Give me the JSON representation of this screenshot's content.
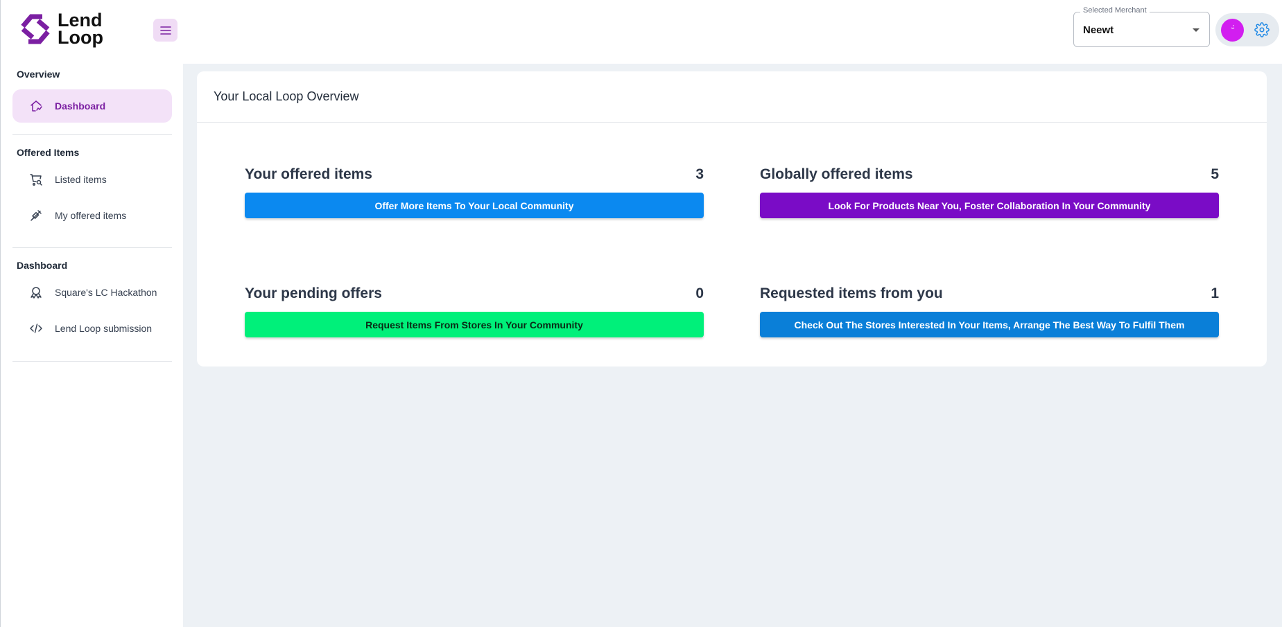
{
  "brand": {
    "name_line1": "Lend",
    "name_line2": "Loop",
    "accent": "#7b1fa2"
  },
  "header": {
    "merchant_label": "Selected Merchant",
    "merchant_value": "Neewt"
  },
  "sidebar": {
    "sections": [
      {
        "title": "Overview",
        "items": [
          {
            "label": "Dashboard",
            "icon": "home-chart-icon",
            "active": true
          }
        ]
      },
      {
        "title": "Offered Items",
        "items": [
          {
            "label": "Listed items",
            "icon": "cart-search-icon"
          },
          {
            "label": "My offered items",
            "icon": "pill-icon"
          }
        ]
      },
      {
        "title": "Dashboard",
        "items": [
          {
            "label": "Square's LC Hackathon",
            "icon": "award-icon"
          },
          {
            "label": "Lend Loop submission",
            "icon": "code-icon"
          }
        ]
      }
    ]
  },
  "main": {
    "card_title": "Your Local Loop Overview",
    "stats": [
      {
        "label": "Your offered items",
        "count": "3",
        "button": "Offer More Items To Your Local Community",
        "color": "#0b89f0",
        "text_color": "#ffffff"
      },
      {
        "label": "Globally offered items",
        "count": "5",
        "button": "Look For Products Near You, Foster Collaboration In Your Community",
        "color": "#7a0cc6",
        "text_color": "#ffffff"
      },
      {
        "label": "Your pending offers",
        "count": "0",
        "button": "Request Items From Stores In Your Community",
        "color": "#00f07a",
        "text_color": "#0a2a15"
      },
      {
        "label": "Requested items from you",
        "count": "1",
        "button": "Check Out The Stores Interested In Your Items, Arrange The Best Way To Fulfil Them",
        "color": "#0a7fd8",
        "text_color": "#ffffff"
      }
    ]
  }
}
